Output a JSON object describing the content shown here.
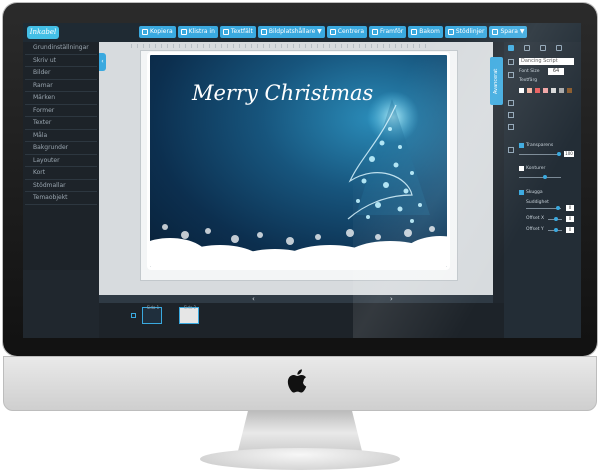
{
  "app": {
    "logo_text": "Inkabel"
  },
  "toolbar": {
    "buttons": [
      {
        "label": "Kopiera",
        "icon": "copy-icon"
      },
      {
        "label": "Klistra in",
        "icon": "paste-icon"
      },
      {
        "label": "Textfält",
        "icon": "textfield-icon"
      },
      {
        "label": "Bildplatshållare ▼",
        "icon": "image-placeholder-icon"
      },
      {
        "label": "Centrera",
        "icon": "center-icon"
      },
      {
        "label": "Framför",
        "icon": "bring-forward-icon"
      },
      {
        "label": "Bakom",
        "icon": "send-backward-icon"
      },
      {
        "label": "Stödlinjer",
        "icon": "guides-icon"
      },
      {
        "label": "Spara ▼",
        "icon": "save-icon"
      }
    ]
  },
  "sidebar": {
    "items": [
      {
        "label": "Grundinställningar"
      },
      {
        "label": "Skriv ut"
      },
      {
        "label": "Bilder"
      },
      {
        "label": "Ramar"
      },
      {
        "label": "Märken"
      },
      {
        "label": "Former"
      },
      {
        "label": "Texter"
      },
      {
        "label": "Måla"
      },
      {
        "label": "Bakgrunder"
      },
      {
        "label": "Layouter"
      },
      {
        "label": "Kort"
      },
      {
        "label": "Stödmallar"
      },
      {
        "label": "Temaobjekt"
      }
    ],
    "collapse_glyph": "‹"
  },
  "canvas": {
    "card_title": "Merry Christmas",
    "prev_arrow": "‹",
    "next_arrow": "›"
  },
  "side_tab": {
    "label": "Avancerat"
  },
  "pages": {
    "thumbs": [
      {
        "label": "Sida 1"
      },
      {
        "label": "Sida 2"
      }
    ]
  },
  "right_panel": {
    "font_name": "Dancing Script",
    "font_size_label": "Font Size",
    "font_size_value": "64",
    "text_color_label": "Textfärg",
    "transparency_label": "Transparens",
    "transparency_value": "100",
    "contour_label": "Konturer",
    "shadow_label": "Skugga",
    "blur_label": "Suddighet",
    "blur_value": "0",
    "offset_x_label": "Offset X",
    "offset_x_value": "0",
    "offset_y_label": "Offset Y",
    "offset_y_value": "0",
    "swatches": [
      "#ffffff",
      "#f3b4a0",
      "#e85a5a",
      "#f0a3a3",
      "#d9d9d9",
      "#aaaaaa",
      "#8b5a2b"
    ]
  },
  "colors": {
    "accent": "#3aa9df",
    "card_bg": "#0c2f4f",
    "screen_bg": "#20272e"
  }
}
